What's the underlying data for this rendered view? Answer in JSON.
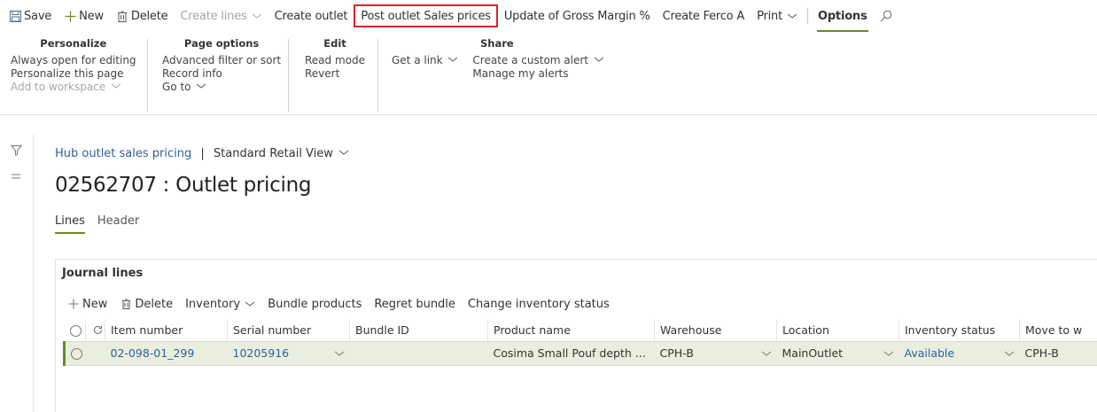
{
  "toolbar": {
    "save": "Save",
    "new": "New",
    "delete": "Delete",
    "create_lines": "Create lines",
    "create_outlet": "Create outlet",
    "post_outlet_sales_prices": "Post outlet Sales prices",
    "update_gross_margin": "Update of Gross Margin %",
    "create_ferco": "Create Ferco A",
    "print": "Print",
    "options": "Options"
  },
  "ribbon": {
    "personalize": {
      "title": "Personalize",
      "items": [
        "Always open for editing",
        "Personalize this page",
        "Add to workspace"
      ]
    },
    "page_options": {
      "title": "Page options",
      "items": [
        "Advanced filter or sort",
        "Record info",
        "Go to"
      ]
    },
    "edit": {
      "title": "Edit",
      "items": [
        "Read mode",
        "Revert"
      ]
    },
    "share": {
      "title": "Share",
      "get_link": "Get a link",
      "items": [
        "Create a custom alert",
        "Manage my alerts"
      ]
    }
  },
  "breadcrumb": {
    "link": "Hub outlet sales pricing",
    "separator": "|",
    "view": "Standard Retail View"
  },
  "page_title": "02562707 : Outlet pricing",
  "tabs": [
    "Lines",
    "Header"
  ],
  "journal": {
    "title": "Journal lines",
    "toolbar": {
      "new": "New",
      "delete": "Delete",
      "inventory": "Inventory",
      "bundle_products": "Bundle products",
      "regret_bundle": "Regret bundle",
      "change_inventory_status": "Change inventory status"
    },
    "columns": [
      "Item number",
      "Serial number",
      "Bundle ID",
      "Product name",
      "Warehouse",
      "Location",
      "Inventory status",
      "Move to w"
    ],
    "rows": [
      {
        "item_number": "02-098-01_299",
        "serial_number": "10205916",
        "bundle_id": "",
        "product_name": "Cosima Small Pouf depth ...",
        "warehouse": "CPH-B",
        "location": "MainOutlet",
        "inventory_status": "Available",
        "move_to": "CPH-B"
      }
    ]
  },
  "colors": {
    "accent": "#6a8a1e",
    "link": "#2f5f9e",
    "highlight_border": "#d9232d",
    "selected_row": "#e9eedf"
  }
}
